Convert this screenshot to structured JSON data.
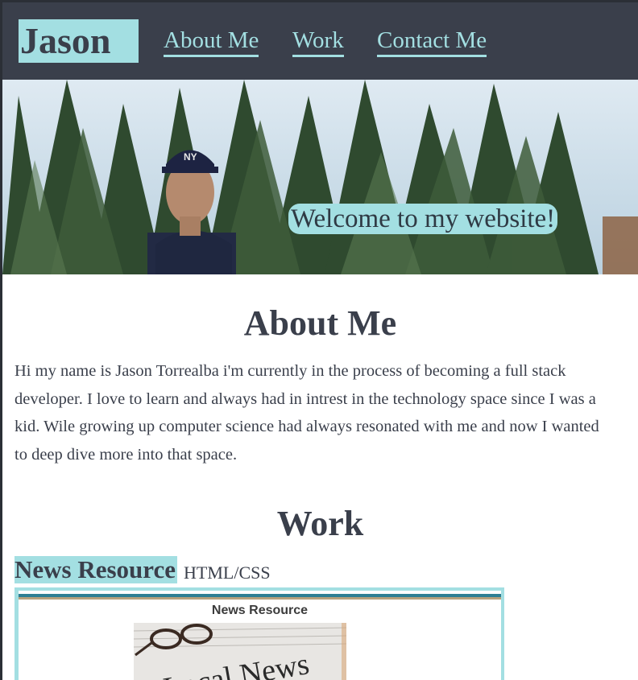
{
  "header": {
    "brand": "Jason",
    "nav": [
      {
        "label": "About Me"
      },
      {
        "label": "Work"
      },
      {
        "label": "Contact Me"
      }
    ]
  },
  "hero": {
    "welcome": "Welcome to my website!"
  },
  "about": {
    "title": "About Me",
    "text": "Hi my name is Jason Torrealba i'm currently in the process of becoming a full stack developer. I love to learn and always had in intrest in the technology space since I was a kid. Wile growing up computer science had always resonated with me and now I wanted to deep dive more into that space."
  },
  "work": {
    "title": "Work",
    "projects": [
      {
        "name": "News Resource",
        "tech": "HTML/CSS",
        "preview_title": "News Resource",
        "preview_image_text": "Local News"
      }
    ]
  },
  "colors": {
    "header_bg": "#3a3f4b",
    "accent": "#a3dfe2",
    "text": "#3a3f4b",
    "page_bg": "#ffffff"
  },
  "icons": {
    "hero_image": "portrait-photo-with-pine-trees",
    "preview_image": "newspaper-with-glasses-photo"
  }
}
